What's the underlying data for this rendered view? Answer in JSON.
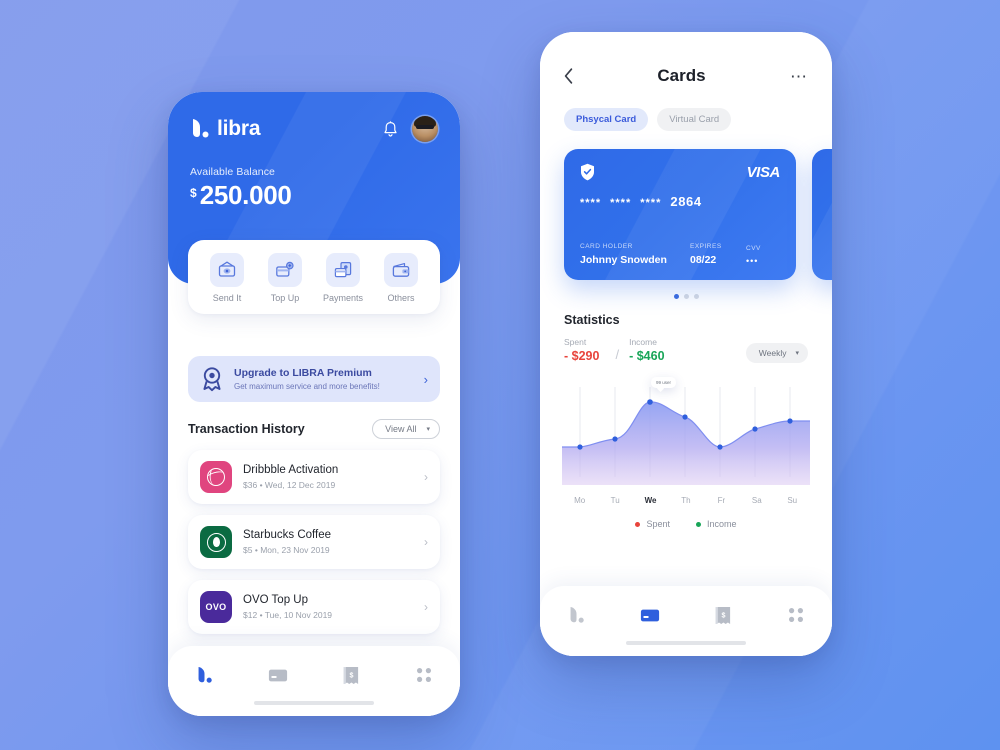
{
  "theme": {
    "bg_from": "#8099ec",
    "bg_to": "#5e92f0",
    "brand_blue": "#2f6ae8",
    "accent_indigo": "#3b5bdb",
    "spent_red": "#e8443c",
    "income_green": "#18a558"
  },
  "left_phone": {
    "brand": {
      "name": "libra",
      "logo_icon": "libra-leaf-logo"
    },
    "header_icons": {
      "bell": "bell-icon",
      "avatar": "user-avatar"
    },
    "balance": {
      "label": "Available Balance",
      "currency": "$",
      "amount": "250.000"
    },
    "quick_actions": [
      {
        "label": "Send It",
        "icon": "send-money-icon"
      },
      {
        "label": "Top Up",
        "icon": "top-up-icon"
      },
      {
        "label": "Payments",
        "icon": "payments-card-icon"
      },
      {
        "label": "Others",
        "icon": "wallet-icon"
      }
    ],
    "promo": {
      "icon": "premium-badge-icon",
      "title": "Upgrade to LIBRA Premium",
      "subtitle": "Get maximum service and more benefits!",
      "chevron": "›"
    },
    "transactions_section": {
      "title": "Transaction History",
      "view_all_label": "View All",
      "view_all_caret": "▾"
    },
    "transactions": [
      {
        "icon": "dribbble-logo",
        "title": "Dribbble Activation",
        "amount": "$36",
        "date": "Wed, 12 Dec 2019",
        "chevron": "›"
      },
      {
        "icon": "starbucks-logo",
        "title": "Starbucks Coffee",
        "amount": "$5",
        "date": "Mon, 23 Nov 2019",
        "chevron": "›"
      },
      {
        "icon": "ovo-logo",
        "title": "OVO Top Up",
        "amount": "$12",
        "date": "Tue, 10 Nov 2019",
        "chevron": "›",
        "mark_text": "OVO"
      }
    ],
    "separator": "•",
    "tabbar": [
      {
        "icon": "home-libra-icon",
        "active": true
      },
      {
        "icon": "card-icon",
        "active": false
      },
      {
        "icon": "receipt-icon",
        "active": false
      },
      {
        "icon": "grid-menu-icon",
        "active": false
      }
    ]
  },
  "right_phone": {
    "header": {
      "back_icon": "chevron-left-icon",
      "title": "Cards",
      "more_icon": "more-horizontal-icon"
    },
    "tabs": [
      {
        "label": "Phsycal Card",
        "active": true
      },
      {
        "label": "Virtual Card",
        "active": false
      }
    ],
    "card": {
      "chip_icon": "shield-check-icon",
      "network": "VISA",
      "masked_groups": [
        "****",
        "****",
        "****"
      ],
      "last4": "2864",
      "holder_label": "CARD HOLDER",
      "holder_value": "Johnny Snowden",
      "expires_label": "EXPIRES",
      "expires_value": "08/22",
      "cvv_label": "CVV",
      "cvv_value": "•••"
    },
    "pager": {
      "total": 3,
      "active_index": 0
    },
    "statistics": {
      "title": "Statistics",
      "spent_label": "Spent",
      "spent_value": "- $290",
      "divider": "/",
      "income_label": "Income",
      "income_value": "- $460",
      "range_label": "Weekly",
      "range_caret": "▾",
      "tooltip": "99 user"
    },
    "legend": [
      {
        "label": "Spent",
        "color": "#e8443c"
      },
      {
        "label": "Income",
        "color": "#18a558"
      }
    ],
    "tabbar": [
      {
        "icon": "home-libra-icon",
        "active": false
      },
      {
        "icon": "card-icon",
        "active": true
      },
      {
        "icon": "receipt-icon",
        "active": false
      },
      {
        "icon": "grid-menu-icon",
        "active": false
      }
    ]
  },
  "chart_data": {
    "type": "area",
    "title": "Statistics",
    "categories": [
      "Mo",
      "Tu",
      "We",
      "Th",
      "Fr",
      "Sa",
      "Su"
    ],
    "series": [
      {
        "name": "Spent",
        "values": [
          30,
          38,
          76,
          64,
          30,
          48,
          58
        ]
      }
    ],
    "highlight_category": "We",
    "annotation": "99 user",
    "ylim": [
      0,
      100
    ],
    "grid": "vertical",
    "legend_position": "bottom",
    "xlabel": "",
    "ylabel": ""
  }
}
